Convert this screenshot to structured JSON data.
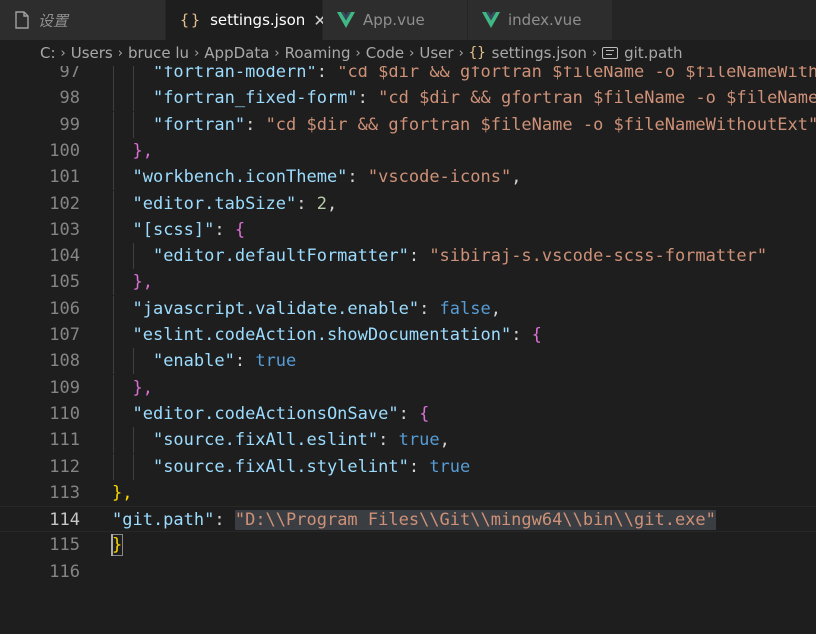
{
  "tabs": [
    {
      "label": "设置",
      "icon": "settings-file-icon"
    },
    {
      "label": "settings.json",
      "icon": "json-braces-icon",
      "close": "✕"
    },
    {
      "label": "App.vue",
      "icon": "vue-icon"
    },
    {
      "label": "index.vue",
      "icon": "vue-icon"
    }
  ],
  "breadcrumb": {
    "items": [
      "C:",
      "Users",
      "bruce lu",
      "AppData",
      "Roaming",
      "Code",
      "User",
      "settings.json",
      "git.path"
    ],
    "separator": "›"
  },
  "editor": {
    "lines": [
      {
        "n": "97",
        "t": [
          "    ",
          "\"fortran-modern\"",
          ": ",
          "\"cd $dir && gfortran $fileName -o $fileNameWithoutExt\""
        ]
      },
      {
        "n": "98",
        "t": [
          "    ",
          "\"fortran_fixed-form\"",
          ": ",
          "\"cd $dir && gfortran $fileName -o $fileNameWithoutExt\""
        ]
      },
      {
        "n": "99",
        "t": [
          "    ",
          "\"fortran\"",
          ": ",
          "\"cd $dir && gfortran $fileName -o $fileNameWithoutExt\""
        ]
      },
      {
        "n": "100",
        "t": [
          "  ",
          "},"
        ]
      },
      {
        "n": "101",
        "t": [
          "  ",
          "\"workbench.iconTheme\"",
          ": ",
          "\"vscode-icons\"",
          ","
        ]
      },
      {
        "n": "102",
        "t": [
          "  ",
          "\"editor.tabSize\"",
          ": ",
          "2",
          ","
        ]
      },
      {
        "n": "103",
        "t": [
          "  ",
          "\"[scss]\"",
          ": ",
          "{"
        ]
      },
      {
        "n": "104",
        "t": [
          "    ",
          "\"editor.defaultFormatter\"",
          ": ",
          "\"sibiraj-s.vscode-scss-formatter\""
        ]
      },
      {
        "n": "105",
        "t": [
          "  ",
          "},"
        ]
      },
      {
        "n": "106",
        "t": [
          "  ",
          "\"javascript.validate.enable\"",
          ": ",
          "false",
          ","
        ]
      },
      {
        "n": "107",
        "t": [
          "  ",
          "\"eslint.codeAction.showDocumentation\"",
          ": ",
          "{"
        ]
      },
      {
        "n": "108",
        "t": [
          "    ",
          "\"enable\"",
          ": ",
          "true"
        ]
      },
      {
        "n": "109",
        "t": [
          "  ",
          "},"
        ]
      },
      {
        "n": "110",
        "t": [
          "  ",
          "\"editor.codeActionsOnSave\"",
          ": ",
          "{"
        ]
      },
      {
        "n": "111",
        "t": [
          "    ",
          "\"source.fixAll.eslint\"",
          ": ",
          "true",
          ","
        ]
      },
      {
        "n": "112",
        "t": [
          "    ",
          "\"source.fixAll.stylelint\"",
          ": ",
          "true"
        ]
      },
      {
        "n": "113",
        "t": [
          "",
          "},"
        ]
      },
      {
        "n": "114",
        "t": [
          "",
          "\"git.path\"",
          ": ",
          "\"D:\\\\Program Files\\\\Git\\\\mingw64\\\\bin\\\\git.exe\""
        ]
      },
      {
        "n": "115",
        "t": [
          "",
          "}"
        ]
      },
      {
        "n": "116",
        "t": [
          ""
        ]
      }
    ]
  },
  "colors": {
    "key": "#9cdcfe",
    "string": "#ce9178",
    "number": "#b5cea8",
    "keyword": "#569cd6",
    "bracket_nested": "#da70d6",
    "bracket_top": "#ffd700"
  }
}
